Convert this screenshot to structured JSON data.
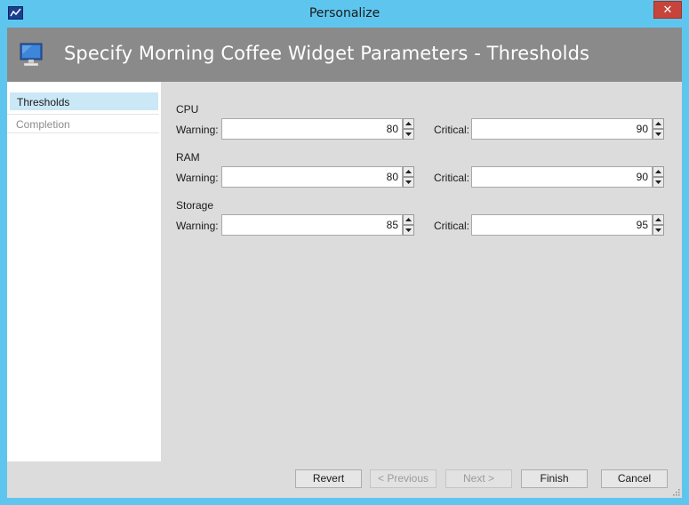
{
  "window": {
    "title": "Personalize",
    "close_label": "✕"
  },
  "header": {
    "title": "Specify Morning Coffee Widget Parameters - Thresholds"
  },
  "sidebar": {
    "items": [
      {
        "label": "Thresholds",
        "active": true
      },
      {
        "label": "Completion",
        "active": false
      }
    ]
  },
  "thresholds": {
    "groups": [
      {
        "name": "CPU",
        "warning_label": "Warning:",
        "warning": "80",
        "critical_label": "Critical:",
        "critical": "90"
      },
      {
        "name": "RAM",
        "warning_label": "Warning:",
        "warning": "80",
        "critical_label": "Critical:",
        "critical": "90"
      },
      {
        "name": "Storage",
        "warning_label": "Warning:",
        "warning": "85",
        "critical_label": "Critical:",
        "critical": "95"
      }
    ]
  },
  "footer": {
    "revert": "Revert",
    "previous": "< Previous",
    "next": "Next >",
    "finish": "Finish",
    "cancel": "Cancel"
  },
  "colors": {
    "frame": "#5ec6ee",
    "header_bg": "#8a8a8a",
    "close_btn": "#c7443a",
    "nav_active": "#cbe8f6"
  }
}
